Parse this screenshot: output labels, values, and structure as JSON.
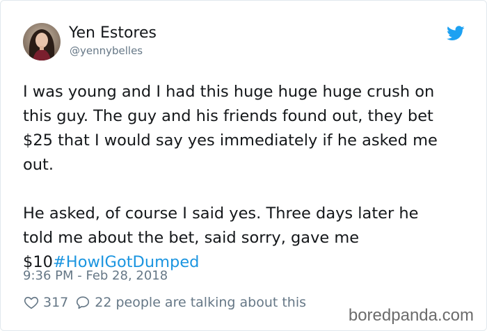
{
  "user": {
    "display_name": "Yen Estores",
    "handle": "@yennybelles"
  },
  "tweet": {
    "lines_para1": [
      "I was young and I had this huge huge huge crush on",
      "this guy. The guy and his friends found out, they bet",
      "$25 that I would say yes immediately if he asked me",
      "out."
    ],
    "lines_para2": [
      "He asked, of course I said yes. Three days later he",
      "told me about the bet, said sorry, gave me"
    ],
    "last_line_text": "$10",
    "hashtag": "#HowIGotDumped",
    "timestamp": "9:36 PM - Feb 28, 2018"
  },
  "actions": {
    "likes": "317",
    "talking": "22 people are talking about this"
  },
  "watermark": "boredpanda.com",
  "icons": {
    "brand": "twitter-bird-icon",
    "like": "heart-icon",
    "reply": "speech-bubble-icon"
  },
  "colors": {
    "link": "#1b95e0",
    "twitter_blue": "#1da1f2",
    "text": "#14171a",
    "muted": "#657786"
  }
}
